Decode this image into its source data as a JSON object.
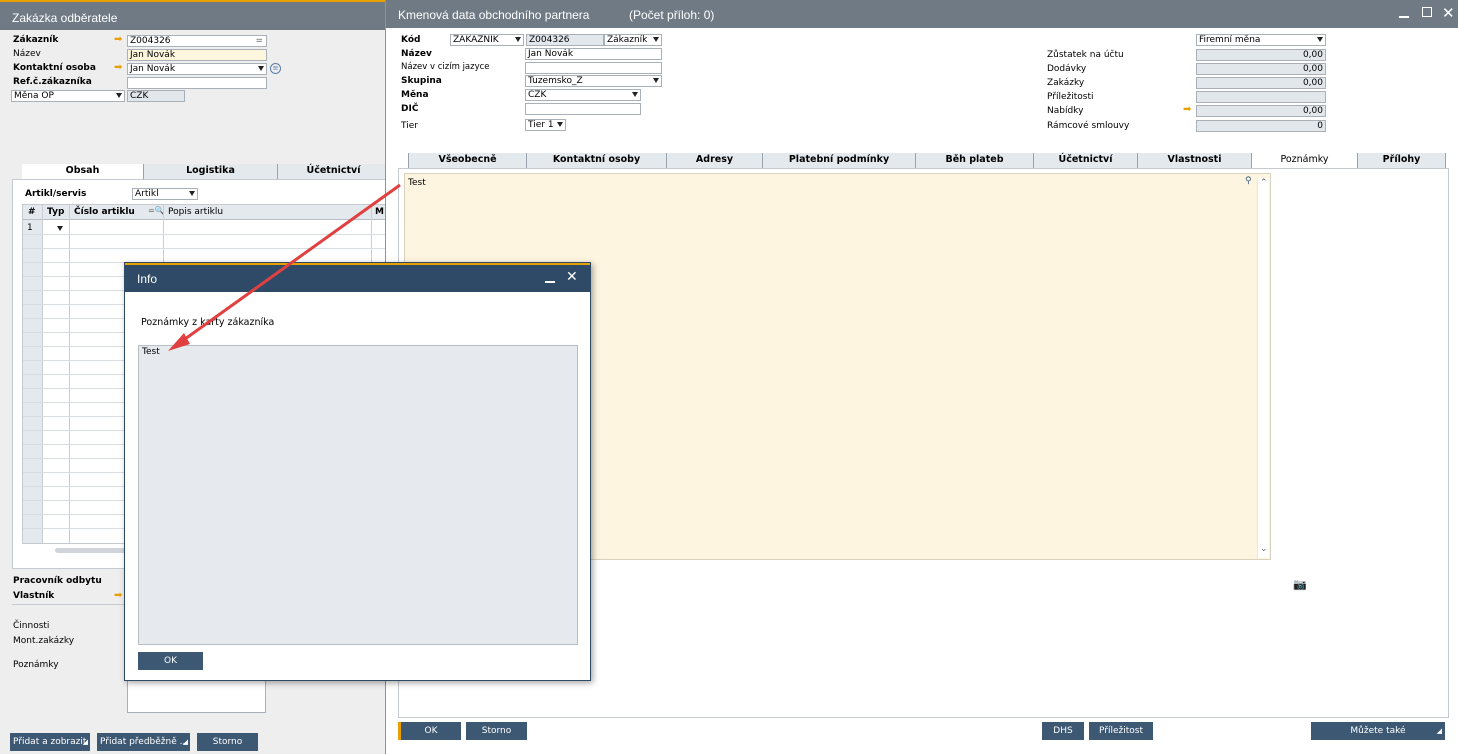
{
  "left": {
    "title": "Zakázka odběratele",
    "fields": {
      "customer_label": "Zákazník",
      "customer_value": "Z004326",
      "name_label": "Název",
      "name_value": "Jan Novák",
      "contact_label": "Kontaktní osoba",
      "contact_value": "Jan Novák",
      "ref_label": "Ref.č.zákazníka",
      "ref_value": "",
      "currency_label": "Měna OP",
      "currency_value": "CZK"
    },
    "tabs": [
      "Obsah",
      "Logistika",
      "Účetnictví"
    ],
    "item_type_label": "Artikl/servis",
    "item_type_value": "Artikl",
    "table": {
      "headers": [
        "#",
        "Typ",
        "Číslo artiklu",
        "Popis artiklu",
        "M"
      ],
      "rows": [
        [
          "1",
          "",
          "",
          "",
          ""
        ]
      ]
    },
    "lower": {
      "sales_employee_label": "Pracovník odbytu",
      "owner_label": "Vlastník",
      "activities_label": "Činnosti",
      "installation_label": "Mont.zakázky",
      "remarks_label": "Poznámky"
    },
    "buttons": {
      "add_view": "Přidat a zobrazit",
      "add_draft": "Přidat předběžně ...",
      "cancel": "Storno"
    }
  },
  "bp": {
    "title": "Kmenová data obchodního partnera",
    "attachments": "(Počet příloh: 0)",
    "fields": {
      "code_label": "Kód",
      "code_type": "ZAKAZNIK",
      "code_value": "Z004326",
      "code_kind": "Zákazník",
      "name_label": "Název",
      "name_value": "Jan Novák",
      "foreign_name_label": "Název v cizím jazyce",
      "foreign_name_value": "",
      "group_label": "Skupina",
      "group_value": "Tuzemsko_Z",
      "currency_label": "Měna",
      "currency_value": "CZK",
      "vat_label": "DIČ",
      "vat_value": "",
      "tier_label": "Tier",
      "tier_value": "Tier 1"
    },
    "right": {
      "currency_select": "Firemní měna",
      "rows": [
        {
          "label": "Zůstatek na účtu",
          "value": "0,00"
        },
        {
          "label": "Dodávky",
          "value": "0,00"
        },
        {
          "label": "Zakázky",
          "value": "0,00"
        },
        {
          "label": "Příležitosti",
          "value": ""
        },
        {
          "label": "Nabídky",
          "value": "0,00"
        },
        {
          "label": "Rámcové smlouvy",
          "value": "0"
        }
      ]
    },
    "tabs": [
      "Všeobecně",
      "Kontaktní osoby",
      "Adresy",
      "Platební podmínky",
      "Běh plateb",
      "Účetnictví",
      "Vlastnosti",
      "Poznámky",
      "Přílohy"
    ],
    "active_tab": "Poznámky",
    "notes_text": "Test",
    "buttons": {
      "ok": "OK",
      "cancel": "Storno",
      "dhs": "DHS",
      "opportunity": "Příležitost",
      "also": "Můžete také"
    }
  },
  "info": {
    "title": "Info",
    "message": "Poznámky z karty zákazníka",
    "text": "Test",
    "ok": "OK"
  },
  "colors": {
    "titlebar": "#6f7a85",
    "dialog_titlebar": "#2e4a66",
    "button": "#3d5873",
    "notes_bg": "#fdf5e0",
    "accent_arrow": "#e8a000",
    "annotation": "#e04040"
  }
}
